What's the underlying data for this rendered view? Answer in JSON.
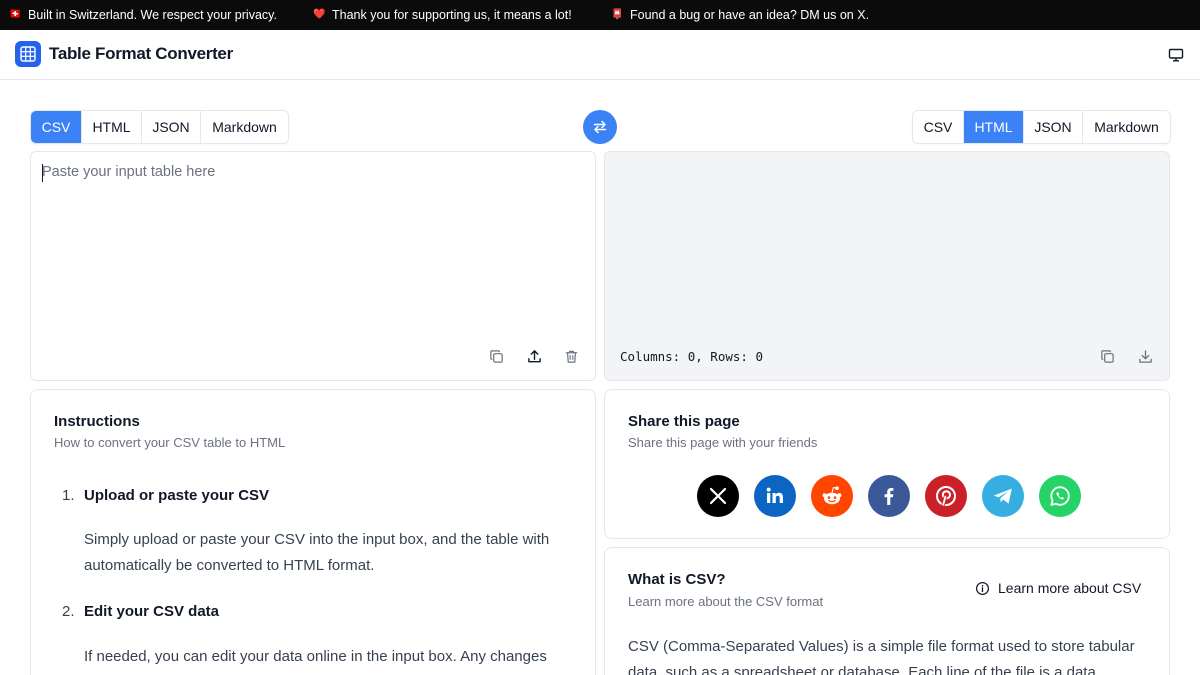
{
  "banner": {
    "messages": [
      {
        "emoji": "🇨🇭",
        "text": "Built in Switzerland. We respect your privacy."
      },
      {
        "emoji": "❤️",
        "text": "Thank you for supporting us, it means a lot!"
      },
      {
        "emoji": "📮",
        "text": "Found a bug or have an idea? DM us on X."
      }
    ]
  },
  "header": {
    "title": "Table Format Converter",
    "logo_icon": "table-grid-icon",
    "display_icon": "monitor-icon"
  },
  "input": {
    "tabs": [
      "CSV",
      "HTML",
      "JSON",
      "Markdown"
    ],
    "active_tab": "CSV",
    "placeholder": "Paste your input table here",
    "value": "",
    "actions": [
      "copy-icon",
      "upload-icon",
      "trash-icon"
    ]
  },
  "output": {
    "tabs": [
      "CSV",
      "HTML",
      "JSON",
      "Markdown"
    ],
    "active_tab": "HTML",
    "stats": "Columns: 0, Rows: 0",
    "actions": [
      "copy-icon",
      "download-icon"
    ]
  },
  "swap_icon": "swap-arrows-icon",
  "instructions": {
    "title": "Instructions",
    "subtitle": "How to convert your CSV table to HTML",
    "steps": [
      {
        "number": "1.",
        "title": "Upload or paste your CSV",
        "body": "Simply upload or paste your CSV into the input box, and the table with automatically be converted to HTML format."
      },
      {
        "number": "2.",
        "title": "Edit your CSV data",
        "body": "If needed, you can edit your data online in the input box. Any changes"
      }
    ]
  },
  "share": {
    "title": "Share this page",
    "subtitle": "Share this page with your friends",
    "buttons": [
      {
        "name": "x",
        "icon": "x-logo-icon",
        "color": "#000000"
      },
      {
        "name": "linkedin",
        "icon": "linkedin-icon",
        "color": "#0a66c2"
      },
      {
        "name": "reddit",
        "icon": "reddit-icon",
        "color": "#ff4500"
      },
      {
        "name": "facebook",
        "icon": "facebook-icon",
        "color": "#3b5998"
      },
      {
        "name": "pinterest",
        "icon": "pinterest-icon",
        "color": "#cb2027"
      },
      {
        "name": "telegram",
        "icon": "telegram-icon",
        "color": "#37aee2"
      },
      {
        "name": "whatsapp",
        "icon": "whatsapp-icon",
        "color": "#25d366"
      }
    ]
  },
  "what_is": {
    "title": "What is CSV?",
    "subtitle": "Learn more about the CSV format",
    "link_label": "Learn more about CSV",
    "body": "CSV (Comma-Separated Values) is a simple file format used to store tabular data, such as a spreadsheet or database. Each line of the file is a data"
  },
  "colors": {
    "accent": "#3b82f6",
    "banner_bg": "#0b0b0c"
  }
}
